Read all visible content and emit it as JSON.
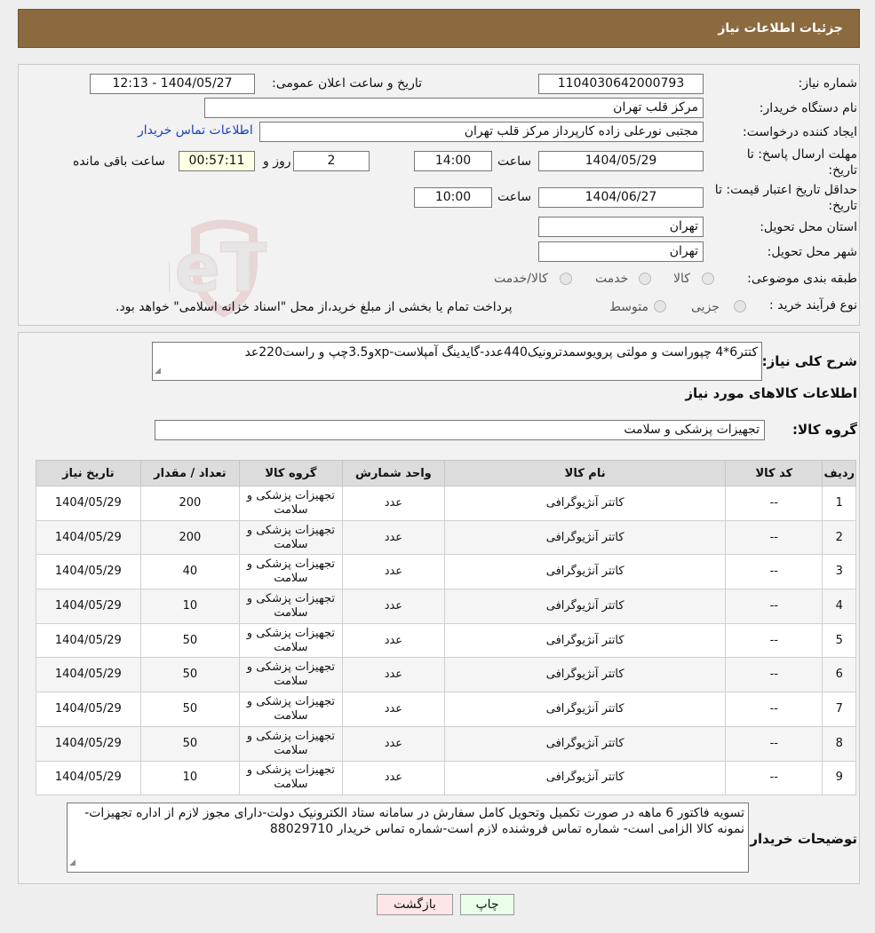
{
  "header": {
    "title": "جزئیات اطلاعات نیاز"
  },
  "info": {
    "need_number_label": "شماره نیاز:",
    "need_number": "1104030642000793",
    "announce_label": "تاریخ و ساعت اعلان عمومی:",
    "announce_value": "1404/05/27 - 12:13",
    "buyer_org_label": "نام دستگاه خریدار:",
    "buyer_org": "مرکز قلب تهران",
    "creator_label": "ایجاد کننده درخواست:",
    "creator": "مجتبی نورعلی زاده کارپرداز مرکز قلب تهران",
    "contact_link": "اطلاعات تماس خریدار",
    "deadline_label_1": "مهلت ارسال پاسخ: تا",
    "deadline_label_2": "تاریخ:",
    "deadline_date": "1404/05/29",
    "time_label": "ساعت",
    "deadline_time": "14:00",
    "days_value": "2",
    "days_label": "روز و",
    "remaining_value": "00:57:11",
    "remaining_label": "ساعت باقی مانده",
    "price_validity_label_1": "حداقل تاریخ اعتبار قیمت: تا",
    "price_validity_label_2": "تاریخ:",
    "price_validity_date": "1404/06/27",
    "price_validity_time": "10:00",
    "province_label": "استان محل تحویل:",
    "province": "تهران",
    "city_label": "شهر محل تحویل:",
    "city": "تهران",
    "category_label": "طبقه بندی موضوعی:",
    "category_options": [
      "کالا",
      "خدمت",
      "کالا/خدمت"
    ],
    "purchase_type_label": "نوع فرآیند خرید :",
    "purchase_type_options": [
      "جزیی",
      "متوسط"
    ],
    "purchase_note": "پرداخت تمام یا بخشی از مبلغ خرید،از محل \"اسناد خزانه اسلامی\" خواهد بود."
  },
  "watermark": {
    "text": "AriaTender.neT"
  },
  "details": {
    "summary_label": "شرح کلی نیاز:",
    "summary": "کتتر6*4 چپوراست و مولتی پرویوسمدترونیک440عدد-گایدینگ آمپلاست-xpو3.5چپ و راست220عد",
    "goods_info_title": "اطلاعات کالاهای مورد نیاز",
    "goods_group_label": "گروه کالا:",
    "goods_group": "تجهیزات پزشکی و سلامت"
  },
  "table": {
    "headers": [
      "ردیف",
      "کد کالا",
      "نام کالا",
      "واحد شمارش",
      "گروه کالا",
      "تعداد / مقدار",
      "تاریخ نیاز"
    ],
    "rows": [
      [
        "1",
        "--",
        "کاتتر آنژیوگرافی",
        "عدد",
        "تجهیزات پزشکی و سلامت",
        "200",
        "1404/05/29"
      ],
      [
        "2",
        "--",
        "کاتتر آنژیوگرافی",
        "عدد",
        "تجهیزات پزشکی و سلامت",
        "200",
        "1404/05/29"
      ],
      [
        "3",
        "--",
        "کاتتر آنژیوگرافی",
        "عدد",
        "تجهیزات پزشکی و سلامت",
        "40",
        "1404/05/29"
      ],
      [
        "4",
        "--",
        "کاتتر آنژیوگرافی",
        "عدد",
        "تجهیزات پزشکی و سلامت",
        "10",
        "1404/05/29"
      ],
      [
        "5",
        "--",
        "کاتتر آنژیوگرافی",
        "عدد",
        "تجهیزات پزشکی و سلامت",
        "50",
        "1404/05/29"
      ],
      [
        "6",
        "--",
        "کاتتر آنژیوگرافی",
        "عدد",
        "تجهیزات پزشکی و سلامت",
        "50",
        "1404/05/29"
      ],
      [
        "7",
        "--",
        "کاتتر آنژیوگرافی",
        "عدد",
        "تجهیزات پزشکی و سلامت",
        "50",
        "1404/05/29"
      ],
      [
        "8",
        "--",
        "کاتتر آنژیوگرافی",
        "عدد",
        "تجهیزات پزشکی و سلامت",
        "50",
        "1404/05/29"
      ],
      [
        "9",
        "--",
        "کاتتر آنژیوگرافی",
        "عدد",
        "تجهیزات پزشکی و سلامت",
        "10",
        "1404/05/29"
      ]
    ]
  },
  "buyer_notes": {
    "label": "توضیحات خریدار:",
    "text": "تسویه فاکتور 6 ماهه در صورت تکمیل وتحویل کامل سفارش در سامانه  ستاد الکترونیک دولت-دارای مجوز لازم از اداره تجهیزات-نمونه کالا الزامی است- شماره تماس فروشنده لازم است-شماره تماس خریدار 88029710"
  },
  "buttons": {
    "print": "چاپ",
    "back": "بازگشت"
  }
}
